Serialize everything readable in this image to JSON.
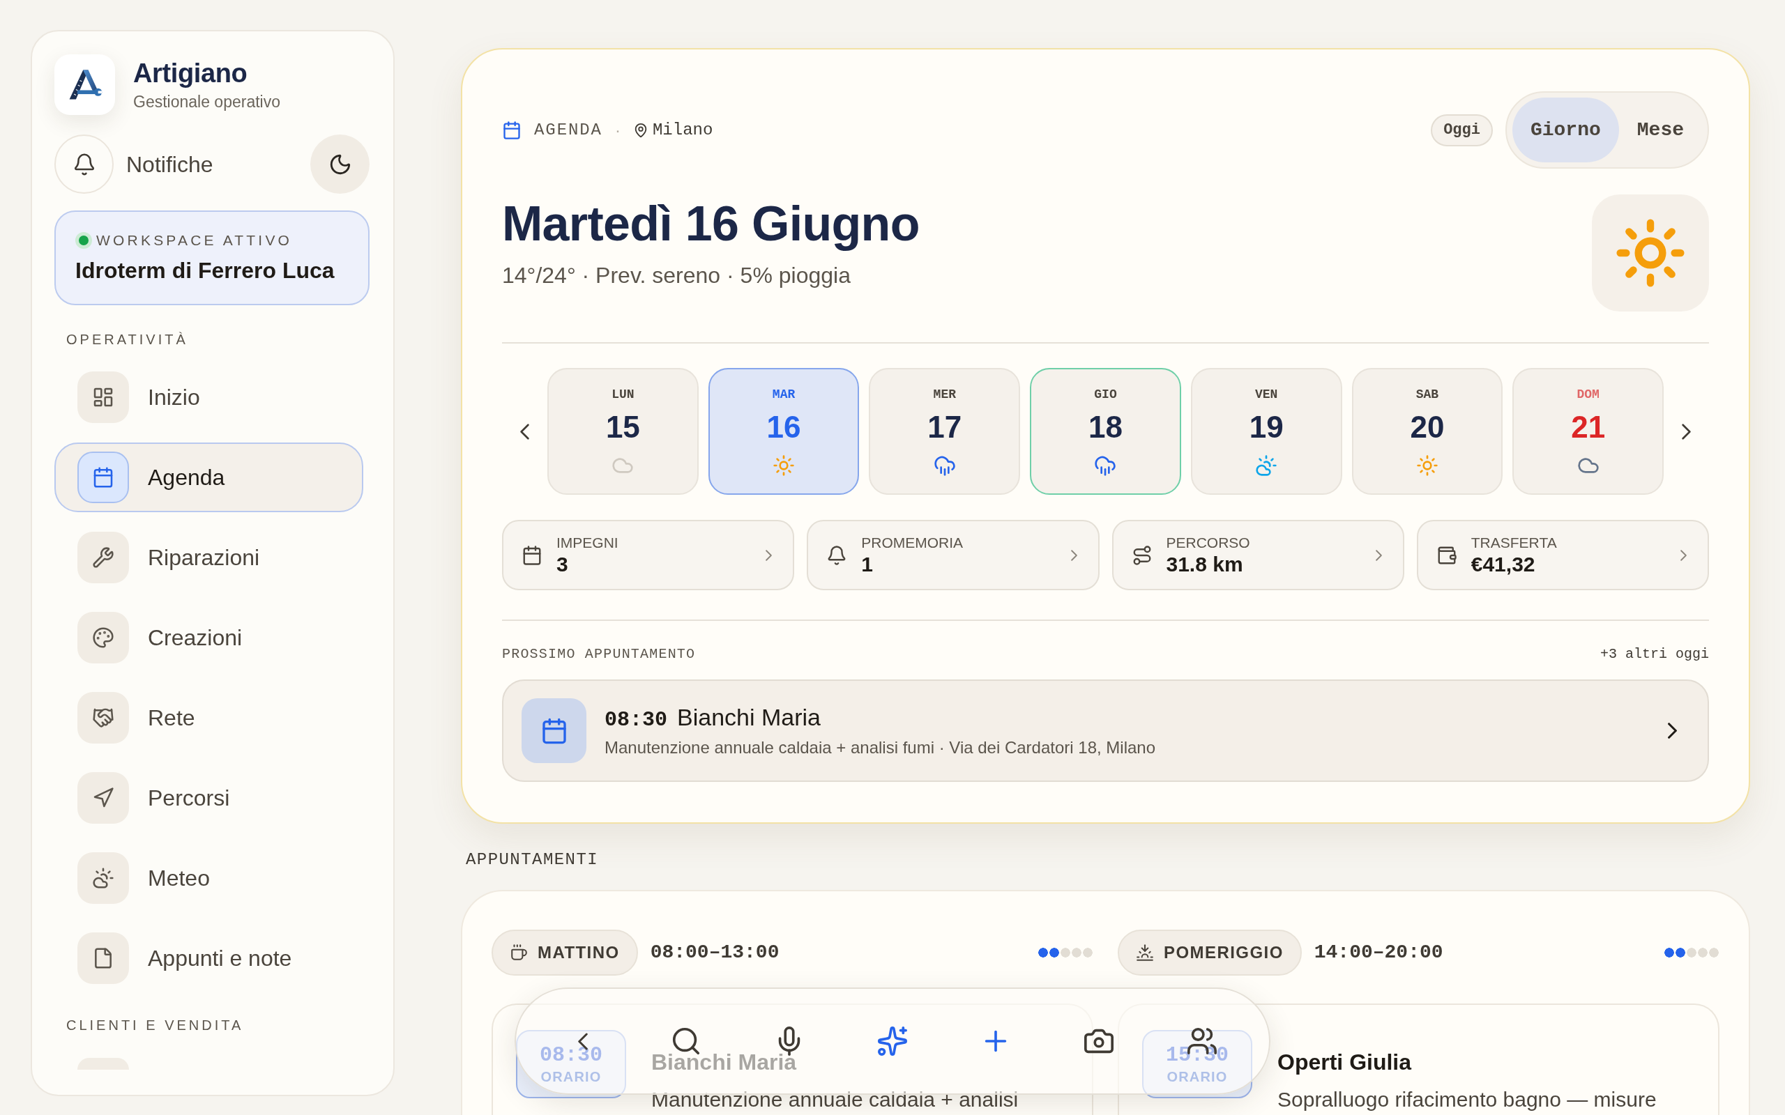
{
  "sidebar": {
    "brand": {
      "name": "Artigiano",
      "tagline": "Gestionale operativo"
    },
    "notifications": "Notifiche",
    "workspace": {
      "label": "WORKSPACE ATTIVO",
      "name": "Idroterm di Ferrero Luca",
      "active": true
    },
    "sections": [
      {
        "title": "OPERATIVITÀ",
        "items": [
          {
            "label": "Inizio",
            "selected": false
          },
          {
            "label": "Agenda",
            "selected": true
          },
          {
            "label": "Riparazioni",
            "selected": false
          },
          {
            "label": "Creazioni",
            "selected": false
          },
          {
            "label": "Rete",
            "selected": false
          },
          {
            "label": "Percorsi",
            "selected": false
          },
          {
            "label": "Meteo",
            "selected": false
          },
          {
            "label": "Appunti e note",
            "selected": false
          }
        ]
      },
      {
        "title": "CLIENTI E VENDITA",
        "items": [
          {
            "selected": false
          }
        ]
      }
    ]
  },
  "agenda": {
    "section": "AGENDA",
    "separator": "·",
    "location": "Milano",
    "today_button": "Oggi",
    "views": [
      {
        "label": "Giorno",
        "selected": true
      },
      {
        "label": "Mese",
        "selected": false
      }
    ],
    "title": "Martedì 16 Giugno",
    "forecast": "14°/24° · Prev. sereno · 5% pioggia",
    "days": [
      {
        "weekday": "LUN",
        "day": "15",
        "selected": false,
        "today": false,
        "holiday": false
      },
      {
        "weekday": "MAR",
        "day": "16",
        "selected": true,
        "today": false,
        "holiday": false
      },
      {
        "weekday": "MER",
        "day": "17",
        "selected": false,
        "today": false,
        "holiday": false
      },
      {
        "weekday": "GIO",
        "day": "18",
        "selected": false,
        "today": true,
        "holiday": false
      },
      {
        "weekday": "VEN",
        "day": "19",
        "selected": false,
        "today": false,
        "holiday": false
      },
      {
        "weekday": "SAB",
        "day": "20",
        "selected": false,
        "today": false,
        "holiday": false
      },
      {
        "weekday": "DOM",
        "day": "21",
        "selected": false,
        "today": false,
        "holiday": true
      }
    ],
    "stats": [
      {
        "label": "IMPEGNI",
        "value": "3"
      },
      {
        "label": "PROMEMORIA",
        "value": "1"
      },
      {
        "label": "PERCORSO",
        "value": "31.8 km"
      },
      {
        "label": "TRASFERTA",
        "value": "€41,32"
      }
    ],
    "next_appointment": {
      "heading": "PROSSIMO APPUNTAMENTO",
      "more": "+3 altri oggi",
      "time": "08:30",
      "client": "Bianchi Maria",
      "details": "Manutenzione annuale caldaia + analisi fumi · Via dei Cardatori 18, Milano"
    }
  },
  "appointments": {
    "heading": "APPUNTAMENTI",
    "periods": [
      {
        "label": "MATTINO",
        "hours": "08:00–13:00",
        "level": 0.4,
        "entries": [
          {
            "time": "08:30",
            "time_label": "ORARIO",
            "client": "Bianchi Maria",
            "details": "Manutenzione annuale caldaia + analisi"
          }
        ]
      },
      {
        "label": "POMERIGGIO",
        "hours": "14:00–20:00",
        "level": 0.4,
        "entries": [
          {
            "time": "15:30",
            "time_label": "ORARIO",
            "client": "Operti Giulia",
            "details": "Sopralluogo rifacimento bagno — misure"
          }
        ]
      }
    ]
  },
  "toolbar": {
    "buttons": [
      {
        "accent": false
      },
      {
        "accent": false
      },
      {
        "accent": false
      },
      {
        "accent": true
      },
      {
        "accent": true
      },
      {
        "accent": false
      },
      {
        "accent": false
      }
    ]
  }
}
